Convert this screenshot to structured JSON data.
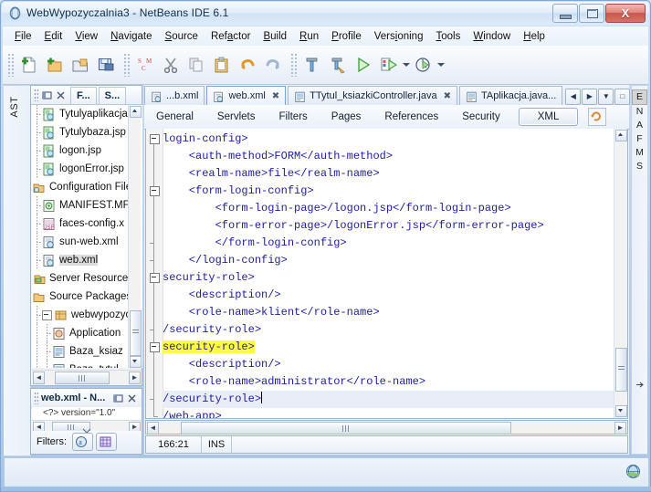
{
  "window": {
    "title": "WebWypozyczalnia3 - NetBeans IDE 6.1",
    "app_icon": "netbeans-window-icon",
    "buttons": {
      "minimize": "–",
      "maximize": "□",
      "close": "X"
    }
  },
  "menubar": {
    "items": [
      {
        "label": "File",
        "mnemonic": "F"
      },
      {
        "label": "Edit",
        "mnemonic": "E"
      },
      {
        "label": "View",
        "mnemonic": "V"
      },
      {
        "label": "Navigate",
        "mnemonic": "N"
      },
      {
        "label": "Source",
        "mnemonic": "S"
      },
      {
        "label": "Refactor",
        "mnemonic": "a"
      },
      {
        "label": "Build",
        "mnemonic": "B"
      },
      {
        "label": "Run",
        "mnemonic": "R"
      },
      {
        "label": "Profile",
        "mnemonic": "P"
      },
      {
        "label": "Versioning",
        "mnemonic": "i"
      },
      {
        "label": "Tools",
        "mnemonic": "T"
      },
      {
        "label": "Window",
        "mnemonic": "W"
      },
      {
        "label": "Help",
        "mnemonic": "H"
      }
    ]
  },
  "toolbar": {
    "groups": [
      [
        "new-file-icon",
        "new-project-icon",
        "open-project-icon",
        "save-all-icon"
      ],
      [
        "scm-icon",
        "cut-icon",
        "copy-icon",
        "paste-icon",
        "undo-icon",
        "redo-icon"
      ],
      [
        "build-icon",
        "clean-build-icon",
        "run-icon",
        "debug-icon",
        "profile-icon"
      ]
    ]
  },
  "left_rail": {
    "label": "AST"
  },
  "projects_panel": {
    "tabs": [
      {
        "label": "F...",
        "name": "files-tab"
      },
      {
        "label": "S...",
        "name": "services-tab"
      }
    ],
    "header_icons": [
      "minimize-window-icon",
      "close-window-icon"
    ],
    "tree": [
      {
        "label": "Tytulyaplikacja",
        "icon": "jsp-file-icon",
        "indent": 1,
        "selected": false
      },
      {
        "label": "Tytulybaza.jsp",
        "icon": "jsp-file-icon",
        "indent": 1,
        "selected": false
      },
      {
        "label": "logon.jsp",
        "icon": "jsp-file-icon",
        "indent": 1,
        "selected": false
      },
      {
        "label": "logonError.jsp",
        "icon": "jsp-file-icon",
        "indent": 1,
        "selected": false
      },
      {
        "label": "Configuration Files",
        "icon": "config-folder-icon",
        "indent": 0,
        "selected": false
      },
      {
        "label": "MANIFEST.MF",
        "icon": "manifest-file-icon",
        "indent": 1,
        "selected": false
      },
      {
        "label": "faces-config.x",
        "icon": "jsf-config-icon",
        "indent": 1,
        "selected": false
      },
      {
        "label": "sun-web.xml",
        "icon": "xml-file-icon",
        "indent": 1,
        "selected": false
      },
      {
        "label": "web.xml",
        "icon": "xml-file-icon",
        "indent": 1,
        "selected": true
      },
      {
        "label": "Server Resources",
        "icon": "server-resources-icon",
        "indent": 0,
        "selected": false
      },
      {
        "label": "Source Packages",
        "icon": "source-packages-icon",
        "indent": 0,
        "selected": false
      },
      {
        "label": "webwypozycza",
        "icon": "package-icon",
        "indent": 1,
        "selected": false,
        "expander": "minus"
      },
      {
        "label": "Application",
        "icon": "java-bean-icon",
        "indent": 2,
        "selected": false
      },
      {
        "label": "Baza_ksiaz",
        "icon": "java-file-icon",
        "indent": 2,
        "selected": false
      },
      {
        "label": "Baza_tytul",
        "icon": "java-file-icon",
        "indent": 2,
        "selected": false
      }
    ]
  },
  "navigator_panel": {
    "title": "web.xml - N...",
    "header_icons": [
      "minimize-window-icon",
      "close-window-icon"
    ],
    "preview_text": "<?> version=\"1.0\"",
    "filters_label": "Filters:",
    "filter_buttons": [
      "attributes-filter-icon",
      "elements-filter-icon"
    ]
  },
  "editor": {
    "document_tabs": [
      {
        "label": "...b.xml",
        "icon": "xml-file-icon",
        "active": false,
        "closable": false
      },
      {
        "label": "web.xml",
        "icon": "xml-file-icon",
        "active": true,
        "closable": true
      },
      {
        "label": "TTytul_ksiazkiController.java",
        "icon": "java-file-icon",
        "active": false,
        "closable": true
      },
      {
        "label": "TAplikacja.java...",
        "icon": "java-file-icon",
        "active": false,
        "closable": false
      }
    ],
    "tab_nav_buttons": [
      "scroll-left-icon",
      "scroll-right-icon",
      "tab-list-icon",
      "maximize-tab-icon"
    ],
    "view_tabs": [
      {
        "label": "General",
        "active": false
      },
      {
        "label": "Servlets",
        "active": false
      },
      {
        "label": "Filters",
        "active": false
      },
      {
        "label": "Pages",
        "active": false
      },
      {
        "label": "References",
        "active": false
      },
      {
        "label": "Security",
        "active": false
      },
      {
        "label": "XML",
        "active": true
      }
    ],
    "view_tabs_extra_icon": "refresh-view-icon",
    "code_lines": [
      {
        "indent": 0,
        "text": "login-config>",
        "fold": "box",
        "highlight": null,
        "current": false
      },
      {
        "indent": 1,
        "text": "<auth-method>FORM</auth-method>",
        "fold": "line",
        "highlight": null,
        "current": false
      },
      {
        "indent": 1,
        "text": "<realm-name>file</realm-name>",
        "fold": "line",
        "highlight": null,
        "current": false
      },
      {
        "indent": 1,
        "text": "<form-login-config>",
        "fold": "box",
        "highlight": null,
        "current": false
      },
      {
        "indent": 2,
        "text": "<form-login-page>/logon.jsp</form-login-page>",
        "fold": "line",
        "highlight": null,
        "current": false
      },
      {
        "indent": 2,
        "text": "<form-error-page>/logonError.jsp</form-error-page>",
        "fold": "line",
        "highlight": null,
        "current": false
      },
      {
        "indent": 2,
        "text": "</form-login-config>",
        "fold": "tick",
        "highlight": null,
        "current": false
      },
      {
        "indent": 1,
        "text": "</login-config>",
        "fold": "tick",
        "highlight": null,
        "current": false
      },
      {
        "indent": 0,
        "text": "security-role>",
        "fold": "box",
        "highlight": null,
        "current": false
      },
      {
        "indent": 1,
        "text": "<description/>",
        "fold": "line",
        "highlight": null,
        "current": false
      },
      {
        "indent": 1,
        "text": "<role-name>klient</role-name>",
        "fold": "line",
        "highlight": null,
        "current": false
      },
      {
        "indent": 0,
        "text": "/security-role>",
        "fold": "tick",
        "highlight": null,
        "current": false
      },
      {
        "indent": 0,
        "text": "security-role>",
        "fold": "box",
        "highlight": "security-role>",
        "current": false
      },
      {
        "indent": 1,
        "text": "<description/>",
        "fold": "line",
        "highlight": null,
        "current": false
      },
      {
        "indent": 1,
        "text": "<role-name>administrator</role-name>",
        "fold": "line",
        "highlight": null,
        "current": false
      },
      {
        "indent": 0,
        "text": "/security-role>",
        "fold": "tick",
        "highlight": null,
        "current": true,
        "caret": true
      },
      {
        "indent": 0,
        "text": "/web-app>",
        "fold": "end",
        "highlight": null,
        "current": false
      }
    ],
    "status": {
      "cursor_position": "166:21",
      "insert_mode": "INS"
    }
  },
  "right_rail": {
    "letters": [
      "E",
      "N",
      "A",
      "F",
      "M",
      "S"
    ],
    "selected": "E"
  },
  "bottom_strip": {
    "icon": "notifications-globe-icon"
  },
  "colors": {
    "xml_text": "#2020a0",
    "highlight": "#ffff3f",
    "current_line": "#e8edf7",
    "selection": "#dcdcdc",
    "title_text": "#12304e"
  }
}
